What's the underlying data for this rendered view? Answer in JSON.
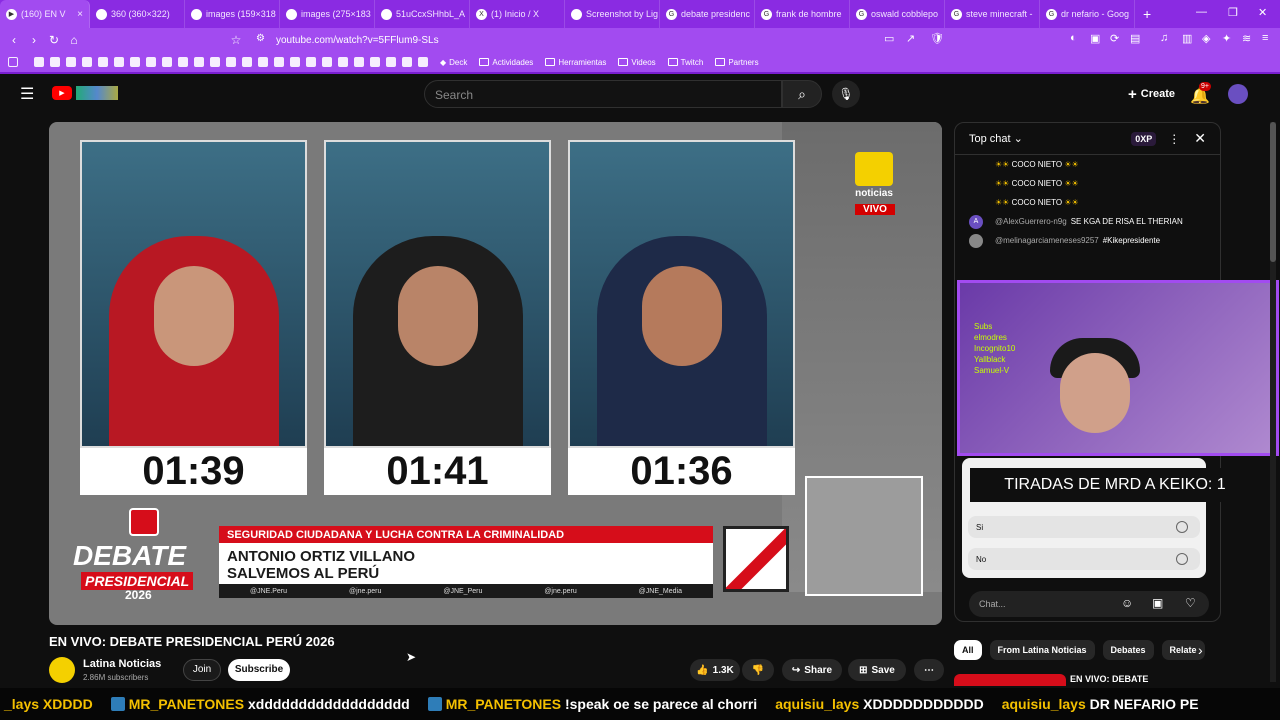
{
  "browser": {
    "tabs": [
      {
        "label": "(160) EN V",
        "active": true
      },
      {
        "label": "360 (360×322)"
      },
      {
        "label": "images (159×318"
      },
      {
        "label": "images (275×183"
      },
      {
        "label": "51uCcxSHhbL_A"
      },
      {
        "label": "(1) Inicio / X"
      },
      {
        "label": "Screenshot by Lig"
      },
      {
        "label": "debate presidenc"
      },
      {
        "label": "frank de hombre"
      },
      {
        "label": "oswald cobblepo"
      },
      {
        "label": "steve minecraft -"
      },
      {
        "label": "dr nefario - Goog"
      }
    ],
    "url": "youtube.com/watch?v=5FFlum9-SLs",
    "bookmarks": [
      "Deck",
      "Actividades",
      "Herramientas",
      "Videos",
      "Twitch",
      "Partners"
    ]
  },
  "youtube": {
    "search_placeholder": "Search",
    "create_label": "Create",
    "notif_badge": "9+"
  },
  "video": {
    "timers": [
      "01:39",
      "01:41",
      "01:36"
    ],
    "brand": "noticias",
    "live": "VIVO",
    "topic": "SEGURIDAD CIUDADANA Y LUCHA CONTRA LA CRIMINALIDAD",
    "candidate_name": "ANTONIO ORTIZ VILLANO",
    "party": "SALVEMOS AL PERÚ",
    "debate_title": "DEBATE",
    "debate_sub": "PRESIDENCIAL",
    "debate_year": "2026",
    "socials": [
      "@JNE.Peru",
      "@jne.peru",
      "@JNE_Peru",
      "@jne.peru",
      "@JNE_Media"
    ],
    "title": "EN VIVO: DEBATE PRESIDENCIAL PERÚ 2026",
    "channel": "Latina Noticias",
    "subscribers": "2.86M subscribers",
    "join": "Join",
    "subscribe": "Subscribe",
    "likes": "1.3K",
    "share": "Share",
    "save": "Save"
  },
  "chat": {
    "mode": "Top chat",
    "points": "0XP",
    "messages": [
      {
        "user": "",
        "text": "COCO NIETO"
      },
      {
        "user": "",
        "text": "COCO NIETO"
      },
      {
        "user": "",
        "text": "COCO NIETO"
      },
      {
        "user": "@AlexGuerrero-n9g",
        "text": "SE KGA DE RISA EL THERIAN"
      },
      {
        "user": "@melinagarciameneses9257",
        "text": "#Kikepresidente"
      }
    ],
    "overlay": "TIRADAS DE MRD A KEIKO: 1",
    "webcam_list": [
      "Subs",
      "elmodres",
      "Incognito10",
      "Yallblack",
      "Samuel-V"
    ],
    "poll_options": [
      "Si",
      "No"
    ],
    "input_placeholder": "Chat..."
  },
  "chips": [
    "All",
    "From Latina Noticias",
    "Debates",
    "Relate"
  ],
  "related_title": "EN VIVO: DEBATE",
  "ticker": [
    {
      "user": "",
      "text": "_lays XDDDD"
    },
    {
      "user": "MR_PANETONES",
      "text": "xdddddddddddddddddd"
    },
    {
      "user": "MR_PANETONES",
      "text": "!speak oe se parece al chorri"
    },
    {
      "user": "aquisiu_lays",
      "text": "XDDDDDDDDDDD"
    },
    {
      "user": "aquisiu_lays",
      "text": "DR NEFARIO PE"
    }
  ]
}
